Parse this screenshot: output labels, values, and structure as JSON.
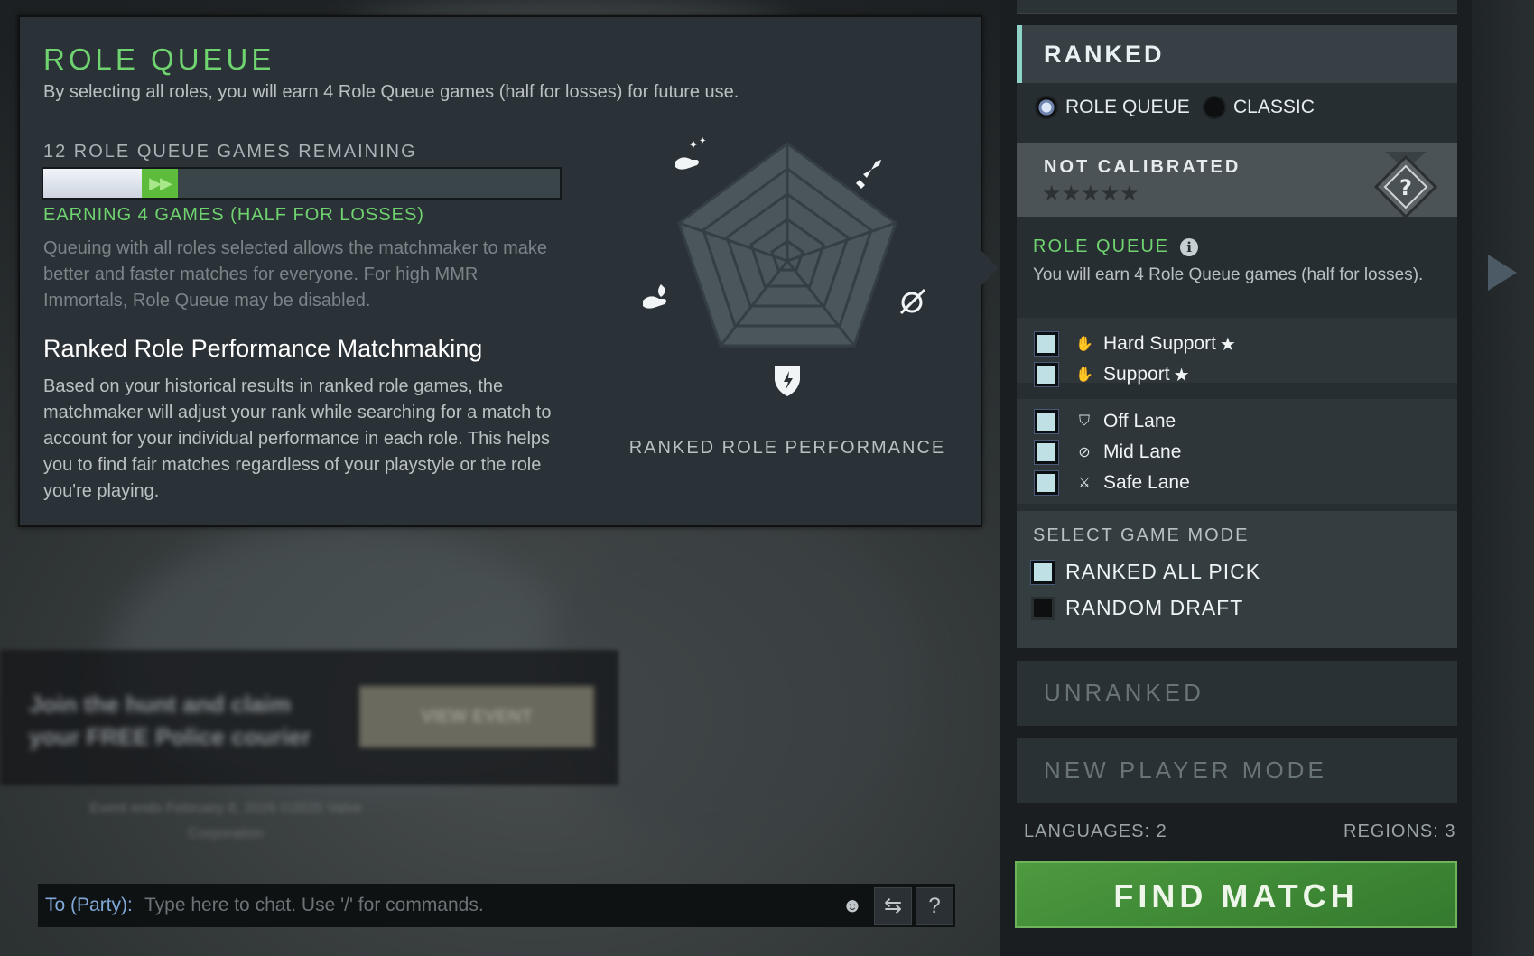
{
  "tooltip": {
    "title": "ROLE QUEUE",
    "subtitle": "By selecting all roles, you will earn 4 Role Queue games (half for losses) for future use.",
    "games_remaining": "12 ROLE QUEUE GAMES REMAINING",
    "progress_fraction": 0.19,
    "earning_fraction": 0.07,
    "earning_label": "EARNING 4 GAMES (HALF FOR LOSSES)",
    "queue_description": "Queuing with all roles selected allows the matchmaker to make better and faster matches for everyone. For high MMR Immortals, Role Queue may be disabled.",
    "rrp_title": "Ranked Role Performance Matchmaking",
    "rrp_description": "Based on your historical results in ranked role games, the matchmaker will adjust your rank while searching for a match to account for your individual performance in each role. This helps you to find fair matches regardless of your playstyle or the role you're playing.",
    "radar_label": "RANKED ROLE PERFORMANCE"
  },
  "ranked": {
    "title": "RANKED",
    "queue_options": [
      {
        "label": "ROLE QUEUE",
        "selected": true
      },
      {
        "label": "CLASSIC",
        "selected": false
      }
    ],
    "calibration": "NOT CALIBRATED",
    "stars": "★★★★★",
    "role_queue_label": "ROLE QUEUE",
    "role_queue_desc": "You will earn 4 Role Queue games (half for losses).",
    "roles": [
      {
        "label": "Hard Support",
        "icon": "hard-support-icon",
        "star": true
      },
      {
        "label": "Support",
        "icon": "support-icon",
        "star": true
      },
      {
        "label": "Off Lane",
        "icon": "offlane-icon",
        "star": false
      },
      {
        "label": "Mid Lane",
        "icon": "midlane-icon",
        "star": false
      },
      {
        "label": "Safe Lane",
        "icon": "safelane-icon",
        "star": false
      }
    ],
    "mode_title": "SELECT GAME MODE",
    "modes": [
      {
        "label": "RANKED ALL PICK",
        "checked": true
      },
      {
        "label": "RANDOM DRAFT",
        "checked": false
      }
    ]
  },
  "unranked": "UNRANKED",
  "new_player_mode": "NEW PLAYER MODE",
  "languages": "LANGUAGES: 2",
  "regions": "REGIONS: 3",
  "find_match": "FIND MATCH",
  "chat": {
    "to": "To (Party):",
    "placeholder": "Type here to chat. Use '/' for commands.",
    "help": "?"
  },
  "promo": {
    "text": "Join the hunt and claim your FREE Police courier",
    "button": "VIEW EVENT",
    "footer": "Event ends February 8, 2026 ©2025 Valve Corporation"
  },
  "colors": {
    "accent_green": "#6fd36f",
    "ranked_stripe": "#8ed3c6",
    "find_match": "#4e9a3f"
  }
}
